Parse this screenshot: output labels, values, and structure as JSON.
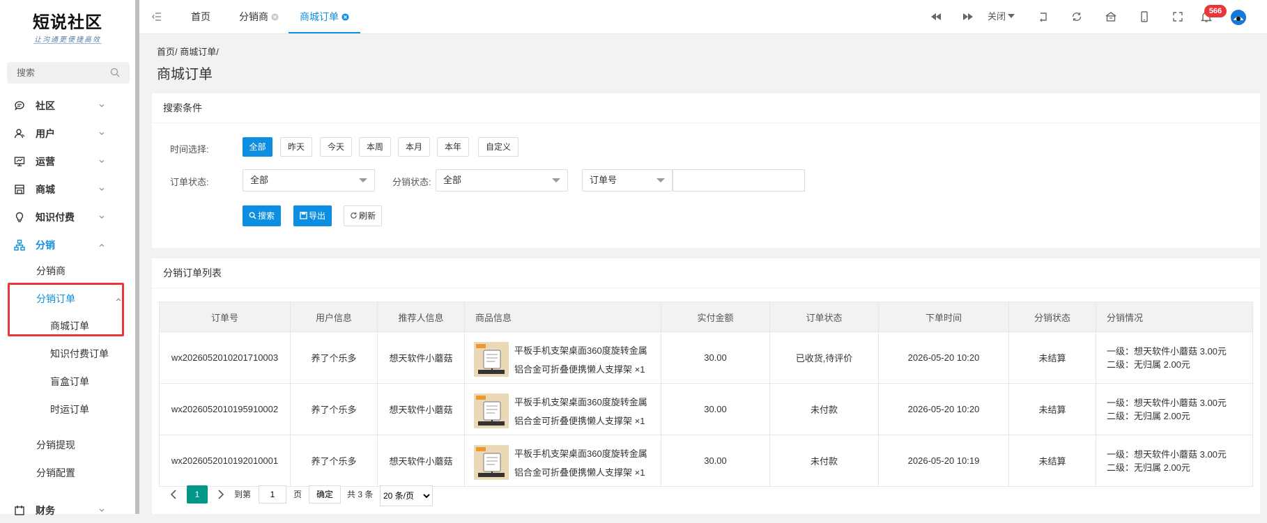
{
  "brand": {
    "title": "短说社区",
    "subtitle": "让沟通更便捷高效"
  },
  "sidebar": {
    "search_placeholder": "搜索",
    "menu": [
      {
        "label": "社区",
        "icon": "chat-bubble-icon"
      },
      {
        "label": "用户",
        "icon": "user-icon"
      },
      {
        "label": "运营",
        "icon": "presentation-icon"
      },
      {
        "label": "商城",
        "icon": "store-icon"
      },
      {
        "label": "知识付费",
        "icon": "lightbulb-icon"
      },
      {
        "label": "分销",
        "icon": "org-chart-icon"
      },
      {
        "label": "财务",
        "icon": "finance-icon"
      }
    ],
    "distribution_sub": {
      "distributor": "分销商",
      "orders": "分销订单",
      "order_types": [
        "商城订单",
        "知识付费订单",
        "盲盒订单",
        "时运订单"
      ],
      "withdraw": "分销提现",
      "config": "分销配置"
    }
  },
  "topbar": {
    "tabs": [
      "首页",
      "分销商",
      "商城订单"
    ],
    "close_label": "关闭",
    "notification_count": "566"
  },
  "breadcrumb": "首页/ 商城订单/",
  "page_title": "商城订单",
  "search_card": {
    "title": "搜索条件",
    "time_label": "时间选择:",
    "time_options": [
      "全部",
      "昨天",
      "今天",
      "本周",
      "本月",
      "本年",
      "自定义"
    ],
    "order_status_label": "订单状态:",
    "order_status_value": "全部",
    "dist_status_label": "分销状态:",
    "dist_status_value": "全部",
    "order_no_select": "订单号",
    "order_no_value": "",
    "buttons": {
      "search": "搜索",
      "export": "导出",
      "refresh": "刷新"
    }
  },
  "list_card": {
    "title": "分销订单列表",
    "columns": [
      "订单号",
      "用户信息",
      "推荐人信息",
      "商品信息",
      "实付金额",
      "订单状态",
      "下单时间",
      "分销状态",
      "分销情况"
    ],
    "rows": [
      {
        "order_no": "wx2026052010201710003",
        "user": "养了个乐多",
        "referrer": "想天软件小蘑菇",
        "goods": "平板手机支架桌面360度旋转金属铝合金可折叠便携懒人支撑架 ×1",
        "amount": "30.00",
        "status": "已收货,待评价",
        "time": "2026-05-20 10:20",
        "dist_status": "未结算",
        "level1": "一级：想天软件小蘑菇 3.00元",
        "level2": "二级：无归属 2.00元"
      },
      {
        "order_no": "wx2026052010195910002",
        "user": "养了个乐多",
        "referrer": "想天软件小蘑菇",
        "goods": "平板手机支架桌面360度旋转金属铝合金可折叠便携懒人支撑架 ×1",
        "amount": "30.00",
        "status": "未付款",
        "time": "2026-05-20 10:20",
        "dist_status": "未结算",
        "level1": "一级：想天软件小蘑菇 3.00元",
        "level2": "二级：无归属 2.00元"
      },
      {
        "order_no": "wx2026052010192010001",
        "user": "养了个乐多",
        "referrer": "想天软件小蘑菇",
        "goods": "平板手机支架桌面360度旋转金属铝合金可折叠便携懒人支撑架 ×1",
        "amount": "30.00",
        "status": "未付款",
        "time": "2026-05-20 10:19",
        "dist_status": "未结算",
        "level1": "一级：想天软件小蘑菇 3.00元",
        "level2": "二级：无归属 2.00元"
      }
    ]
  },
  "pagination": {
    "current_page": "1",
    "goto_label": "到第",
    "goto_value": "1",
    "page_unit": "页",
    "confirm": "确定",
    "total": "共 3 条",
    "page_size": "20 条/页"
  },
  "colors": {
    "primary": "#0c8fe0",
    "pager_active": "#009688",
    "badge": "#e8363a",
    "highlight": "#e8363a"
  }
}
